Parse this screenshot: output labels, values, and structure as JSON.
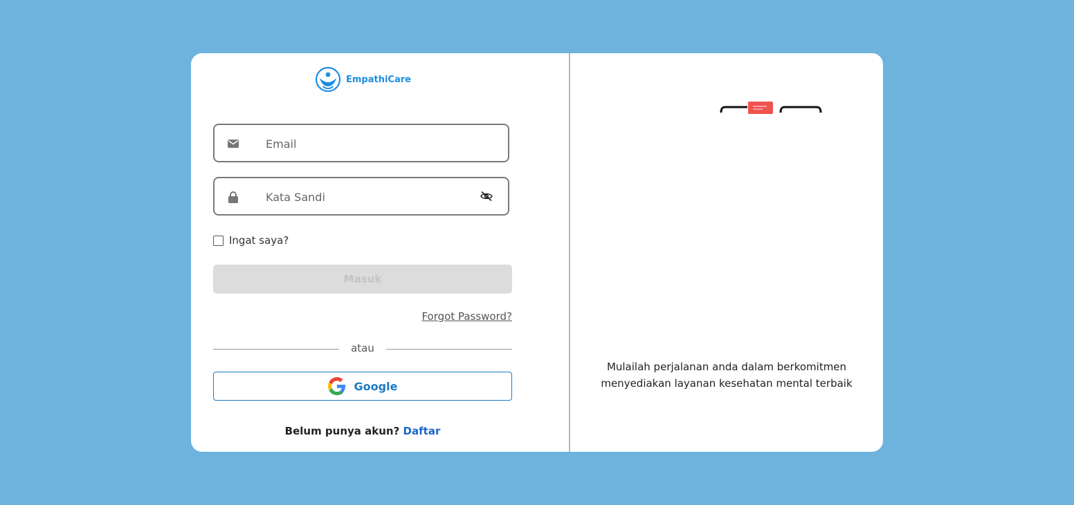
{
  "brand": {
    "name": "EmpathiCare"
  },
  "form": {
    "email_placeholder": "Email",
    "password_placeholder": "Kata Sandi",
    "remember_label": "Ingat saya?",
    "login_label": "Masuk",
    "forgot_label": "Forgot Password?",
    "or_label": "atau",
    "google_label": "Google",
    "signup_prompt": "Belum punya akun?",
    "signup_link": "Daftar"
  },
  "right_panel": {
    "tagline_line1": "Mulailah perjalanan anda dalam berkomitmen",
    "tagline_line2": "menyediakan layanan kesehatan mental terbaik"
  },
  "colors": {
    "background": "#6db3de",
    "accent": "#1a8ee0",
    "link": "#1a66c9",
    "disabled_button": "#dcdcdc"
  },
  "icons": [
    "empathicare-logo-icon",
    "email-icon",
    "lock-icon",
    "eye-off-icon",
    "google-icon"
  ]
}
